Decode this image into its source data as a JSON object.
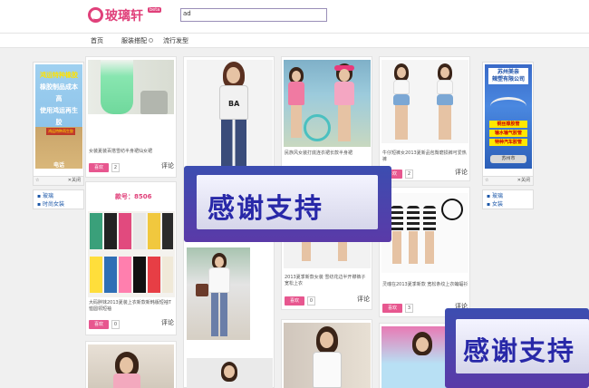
{
  "header": {
    "logo_text": "玻璃轩",
    "logo_badge": "beta",
    "search_value": "ad"
  },
  "nav": {
    "items": [
      "首页",
      "服装搭配",
      "流行发型"
    ]
  },
  "left_ad": {
    "lines": [
      "鸿运特种橡胶",
      "橡胶制品成本高",
      "使用鸿运再生胶",
      "电话13831892660"
    ],
    "stamp": "鸿运特种再生胶",
    "fav": "☆",
    "close": "关闭",
    "links": [
      "玻璃",
      "时尚女装"
    ]
  },
  "right_ad": {
    "title_line1": "苏州美亲",
    "title_line2": "辣塑有限公司",
    "lines": [
      "铜丝橡胶管",
      "输水输气胶管",
      "特种汽车胶管"
    ],
    "caption": "苏州市",
    "fav": "☆",
    "close": "关闭",
    "links": [
      "玻璃",
      "女装"
    ]
  },
  "cards": [
    {
      "desc": "女装夏装百搭雪纺半身裙仙女裙",
      "like": "喜欢",
      "count": "2",
      "comment": "评论"
    },
    {
      "label": "款号：8506",
      "desc": "大码胖妹2013夏装上衣新款新韩版短袖T恤圆领短袖",
      "like": "喜欢",
      "count": "0",
      "comment": "评论"
    },
    {
      "desc": "民族风女装打底连衣裙长款半身裙"
    },
    {
      "desc": "2013夏季新款女装 雪纺花边半开襟裤子 宽松上衣",
      "like": "喜欢",
      "count": "0",
      "comment": "评论"
    },
    {
      "desc": "牛仔短裤女2013夏新品包臀磨损裤可爱热裤",
      "like": "喜欢",
      "count": "2",
      "comment": "评论"
    },
    {
      "desc": "灵魂在2013夏季新款 宽松条纹上衣蝙蝠衫",
      "like": "喜欢",
      "count": "3",
      "comment": "评论"
    }
  ],
  "thanks_text": "感谢支持"
}
